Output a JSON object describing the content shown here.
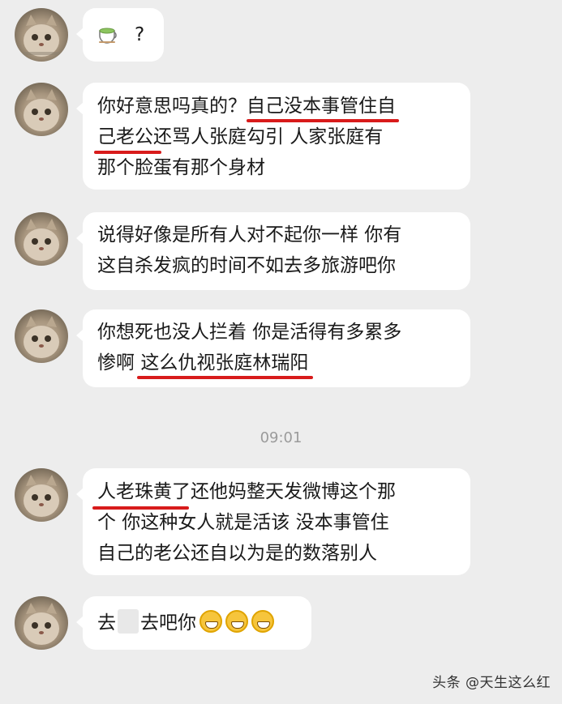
{
  "messages": [
    {
      "id": "m1",
      "text": "?"
    },
    {
      "id": "m2",
      "lines": [
        "你好意思吗真的？",
        "自己没本事管住自",
        "己老公",
        "还骂人张庭勾引  人家张庭有",
        "那个脸蛋有那个身材"
      ]
    },
    {
      "id": "m3",
      "lines": [
        "说得好像是所有人对不起你一样 你有",
        "这自杀发疯的时间不如去多旅游吧你"
      ]
    },
    {
      "id": "m4",
      "lines": [
        "你想死也没人拦着 你是活得有多累多",
        "惨啊 ",
        "这么仇视张庭林瑞阳"
      ]
    },
    {
      "id": "m5",
      "lines": [
        "人老珠黄了",
        "还他妈整天发微博这个那",
        "个 你这种女人就是活该 没本事管住",
        "自己的老公还自以为是的数落别人"
      ]
    },
    {
      "id": "m6",
      "parts": [
        "去",
        "去吧你"
      ]
    }
  ],
  "timestamp": "09:01",
  "watermark": "头条 @天生这么红",
  "icons": {
    "tea": "tea-cup-icon",
    "grin": "grinning-face-icon",
    "avatar": "cat-avatar"
  },
  "colors": {
    "background": "#ededed",
    "bubble": "#ffffff",
    "underline": "#d81b1b"
  }
}
